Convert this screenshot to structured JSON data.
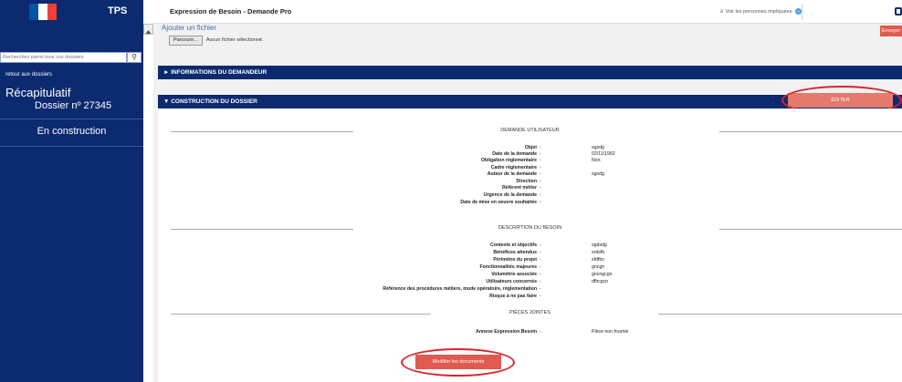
{
  "sidebar": {
    "brand": "TPS",
    "search_placeholder": "Recherchez parmi tous vos dossiers",
    "search_button_icon": "search-icon",
    "back_link": "retour aux dossiers",
    "recap_title": "Récapitulatif",
    "dossier_label": "Dossier nº 27345",
    "status": "En construction",
    "flag_colors": [
      "#0055a4",
      "#ffffff",
      "#ef4135"
    ]
  },
  "header": {
    "title": "Expression de Besoin - Demande Pro",
    "people_link": "Voir les personnes impliquées",
    "people_count": "0"
  },
  "upload": {
    "title": "Ajouter un fichier",
    "browse_label": "Parcourir...",
    "no_file_text": "Aucun fichier sélectionné.",
    "send_label": "Envoyer"
  },
  "sections": {
    "demandeur": "► INFORMATIONS DU DEMANDEUR",
    "construction": "▼ CONSTRUCTION DU DOSSIER",
    "edit_label": "ÉDITER"
  },
  "demande_utilisateur": {
    "heading": "DEMANDE UTILISATEUR",
    "rows": [
      {
        "label": "Objet",
        "value": "sgsdg"
      },
      {
        "label": "Date de la demande",
        "value": "02/11/1992"
      },
      {
        "label": "Obligation réglementaire",
        "value": "Non"
      },
      {
        "label": "Cadre réglementaire",
        "value": ""
      },
      {
        "label": "Auteur de la demande",
        "value": "sgsdg"
      },
      {
        "label": "Direction",
        "value": ""
      },
      {
        "label": "Référent métier",
        "value": ""
      },
      {
        "label": "Urgence de la demande",
        "value": ""
      },
      {
        "label": "Date de mise en oeuvre souhaitée",
        "value": ""
      }
    ]
  },
  "description_besoin": {
    "heading": "DESCRIPTION DU BESOIN",
    "rows": [
      {
        "label": "Contexte et objectifs",
        "value": "sgdsdg"
      },
      {
        "label": "Bénéfices attendus",
        "value": "srdsfb"
      },
      {
        "label": "Périmètre du projet",
        "value": "sfdfbv"
      },
      {
        "label": "Fonctionnalités majeures",
        "value": "gncgn"
      },
      {
        "label": "Volumétrie associée",
        "value": "gncngcgn"
      },
      {
        "label": "Utilisateurs concernés",
        "value": "dfhcgcn"
      },
      {
        "label": "Référence des procédures métiers, mode opératoire, réglementation",
        "value": ""
      },
      {
        "label": "Risque à ne pas faire",
        "value": ""
      }
    ]
  },
  "pieces_jointes": {
    "heading": "PIÈCES JOINTES",
    "rows": [
      {
        "label": "Annexe Expression Besoin",
        "value": "Pièce non fournie"
      }
    ],
    "modify_label": "Modifier les documents"
  },
  "colors": {
    "navy": "#0b2a6f",
    "accent_red": "#e05b4f",
    "annotation_red": "#d9252b"
  }
}
